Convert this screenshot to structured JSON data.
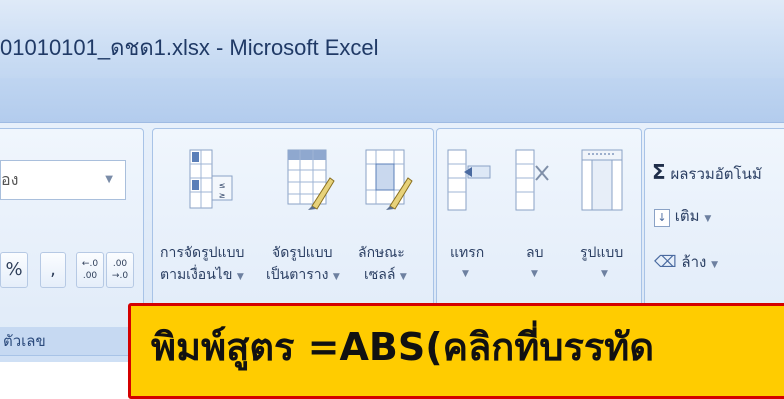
{
  "window": {
    "title": "01010101_ดชด1.xlsx - Microsoft Excel"
  },
  "ribbon": {
    "number_group": {
      "format_combo_value": "อง",
      "percent_label": "%",
      "comma_label": ",",
      "inc_decimal_label": "←.0 .00",
      "dec_decimal_label": ".00 →.0",
      "group_label": "ตัวเลข"
    },
    "styles_group": {
      "conditional_formatting": {
        "line1": "การจัดรูปแบบ",
        "line2": "ตามเงื่อนไข"
      },
      "format_as_table": {
        "line1": "จัดรูปแบบ",
        "line2": "เป็นตาราง"
      },
      "cell_styles": {
        "line1": "ลักษณะ",
        "line2": "เซลล์"
      }
    },
    "cells_group": {
      "insert": "แทรก",
      "delete": "ลบ",
      "format": "รูปแบบ"
    },
    "editing_group": {
      "autosum": "ผลรวมอัตโนมั",
      "fill": "เติม",
      "clear": "ล้าง"
    }
  },
  "overlay": {
    "banner_text": "พิมพ์สูตร =ABS(คลิกที่บรรทัด"
  }
}
